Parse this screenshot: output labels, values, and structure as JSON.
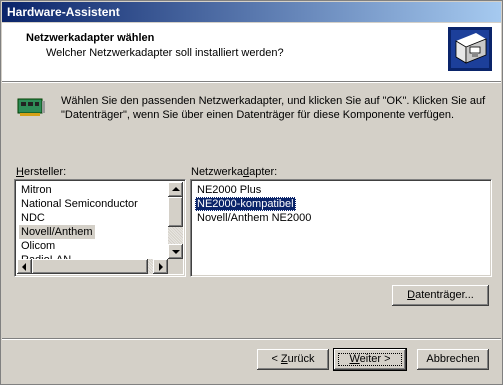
{
  "window": {
    "title": "Hardware-Assistent"
  },
  "header": {
    "title": "Netzwerkadapter wählen",
    "subtitle": "Welcher Netzwerkadapter soll installiert werden?",
    "icon": "network-wizard-icon"
  },
  "info": {
    "icon": "network-card-icon",
    "text": "Wählen Sie den passenden Netzwerkadapter, und klicken Sie auf \"OK\". Klicken Sie auf \"Datenträger\", wenn Sie über einen Datenträger für diese Komponente verfügen."
  },
  "manufacturers": {
    "label_prefix": "",
    "label_accel": "H",
    "label_rest": "ersteller:",
    "items": [
      "Mitron",
      "National Semiconductor",
      "NDC",
      "Novell/Anthem",
      "Olicom",
      "RadioLAN"
    ],
    "selected": "Novell/Anthem"
  },
  "adapters": {
    "label_prefix": "Netzwerka",
    "label_accel": "d",
    "label_rest": "apter:",
    "items": [
      "NE2000 Plus",
      "NE2000-kompatibel",
      "Novell/Anthem NE2000"
    ],
    "selected": "NE2000-kompatibel"
  },
  "buttons": {
    "disk_prefix": "",
    "disk_accel": "D",
    "disk_rest": "atenträger...",
    "back_prefix": "< ",
    "back_accel": "Z",
    "back_rest": "urück",
    "next_prefix": "",
    "next_accel": "W",
    "next_rest": "eiter >",
    "cancel": "Abbrechen"
  }
}
